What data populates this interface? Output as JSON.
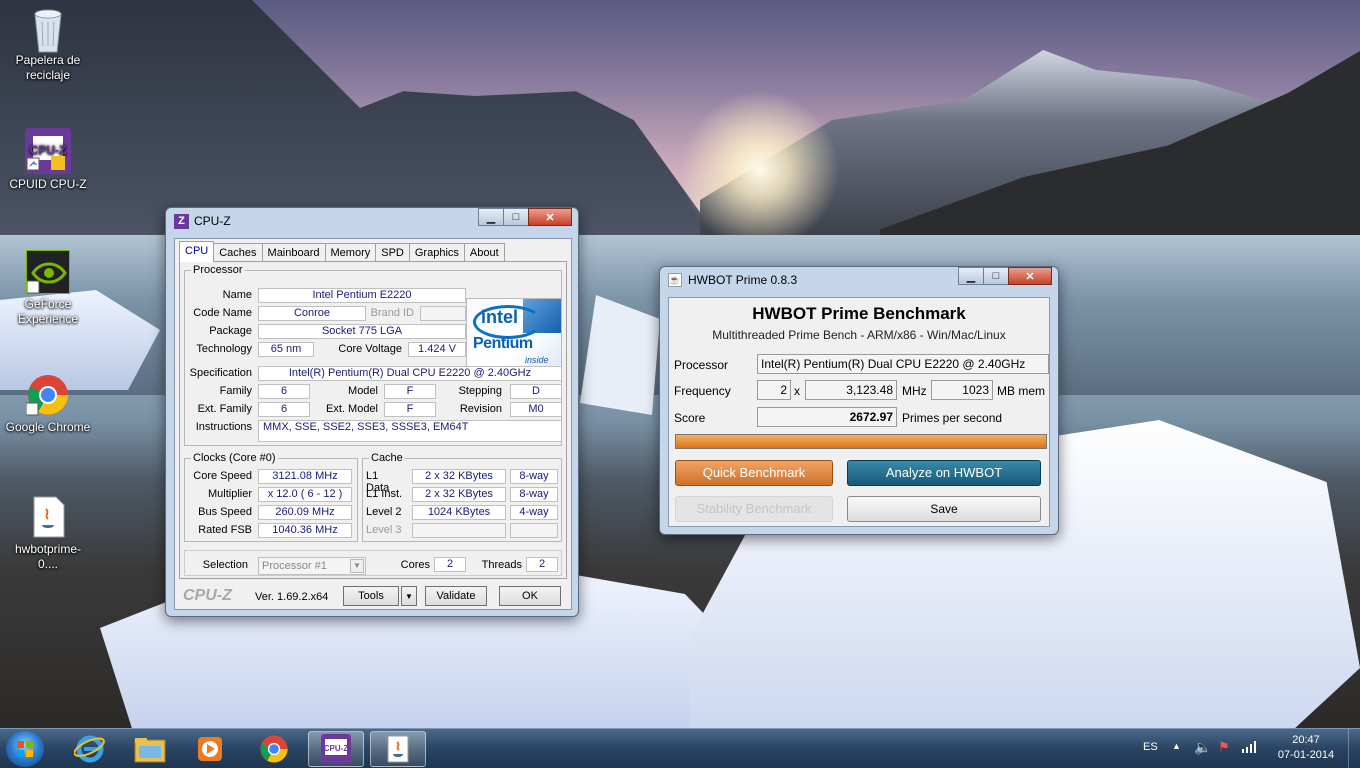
{
  "desktop": {
    "icons": [
      {
        "label_line1": "Papelera de",
        "label_line2": "reciclaje",
        "icon": "recycle-bin-icon"
      },
      {
        "label_line1": "CPUID CPU-Z",
        "label_line2": "",
        "icon": "cpuz-icon"
      },
      {
        "label_line1": "GeForce",
        "label_line2": "Experience",
        "icon": "geforce-icon"
      },
      {
        "label_line1": "Google Chrome",
        "label_line2": "",
        "icon": "chrome-icon"
      },
      {
        "label_line1": "hwbotprime-0....",
        "label_line2": "",
        "icon": "java-file-icon"
      }
    ]
  },
  "cpuz": {
    "title": "CPU-Z",
    "title_icon": "Z",
    "tabs": [
      "CPU",
      "Caches",
      "Mainboard",
      "Memory",
      "SPD",
      "Graphics",
      "About"
    ],
    "active_tab": "CPU",
    "processor": {
      "group": "Processor",
      "name_label": "Name",
      "name": "Intel Pentium E2220",
      "codename_label": "Code Name",
      "codename": "Conroe",
      "brandid_label": "Brand ID",
      "package_label": "Package",
      "package": "Socket 775 LGA",
      "technology_label": "Technology",
      "technology": "65 nm",
      "voltage_label": "Core Voltage",
      "voltage": "1.424 V",
      "spec_label": "Specification",
      "spec": "Intel(R) Pentium(R) Dual  CPU  E2220  @ 2.40GHz",
      "family_label": "Family",
      "family": "6",
      "model_label": "Model",
      "model": "F",
      "stepping_label": "Stepping",
      "stepping": "D",
      "extfamily_label": "Ext. Family",
      "extfamily": "6",
      "extmodel_label": "Ext. Model",
      "extmodel": "F",
      "revision_label": "Revision",
      "revision": "M0",
      "instructions_label": "Instructions",
      "instructions": "MMX, SSE, SSE2, SSE3, SSSE3, EM64T"
    },
    "logo": {
      "brand": "intel",
      "product": "Pentium",
      "tag": "inside"
    },
    "clocks": {
      "group": "Clocks (Core #0)",
      "corespeed_label": "Core Speed",
      "corespeed": "3121.08 MHz",
      "multiplier_label": "Multiplier",
      "multiplier": "x 12.0 ( 6 - 12 )",
      "busspeed_label": "Bus Speed",
      "busspeed": "260.09 MHz",
      "ratedfsb_label": "Rated FSB",
      "ratedfsb": "1040.36 MHz"
    },
    "cache": {
      "group": "Cache",
      "l1d_label": "L1 Data",
      "l1d": "2 x 32 KBytes",
      "l1d_way": "8-way",
      "l1i_label": "L1 Inst.",
      "l1i": "2 x 32 KBytes",
      "l1i_way": "8-way",
      "l2_label": "Level 2",
      "l2": "1024 KBytes",
      "l2_way": "4-way",
      "l3_label": "Level 3"
    },
    "selection_label": "Selection",
    "selection": "Processor #1",
    "cores_label": "Cores",
    "cores": "2",
    "threads_label": "Threads",
    "threads": "2",
    "brand": "CPU-Z",
    "version": "Ver. 1.69.2.x64",
    "tools_button": "Tools",
    "validate_button": "Validate",
    "ok_button": "OK"
  },
  "hwbot": {
    "title": "HWBOT Prime 0.8.3",
    "heading": "HWBOT Prime Benchmark",
    "subheading": "Multithreaded Prime Bench - ARM/x86 - Win/Mac/Linux",
    "processor_label": "Processor",
    "processor": "Intel(R) Pentium(R) Dual  CPU  E2220  @ 2.40GHz",
    "frequency_label": "Frequency",
    "freq_cores": "2",
    "freq_x": "x",
    "freq_mhz": "3,123.48",
    "freq_unit": "MHz",
    "mem": "1023",
    "mem_unit": "MB mem",
    "score_label": "Score",
    "score": "2672.97",
    "score_unit": "Primes per second",
    "progress": 1.0,
    "quick_button": "Quick Benchmark",
    "analyze_button": "Analyze on HWBOT",
    "stability_button": "Stability Benchmark",
    "save_button": "Save"
  },
  "taskbar": {
    "items": [
      "start-orb",
      "internet-explorer-icon",
      "file-explorer-icon",
      "media-player-icon",
      "chrome-icon",
      "cpuz-icon",
      "java-icon"
    ],
    "language": "ES",
    "time": "20:47",
    "date": "07-01-2014"
  },
  "colors": {
    "hwbot_orange": "#e08a3c",
    "hwbot_teal": "#1e6e8e",
    "cpuz_value": "#1a1a7a"
  }
}
